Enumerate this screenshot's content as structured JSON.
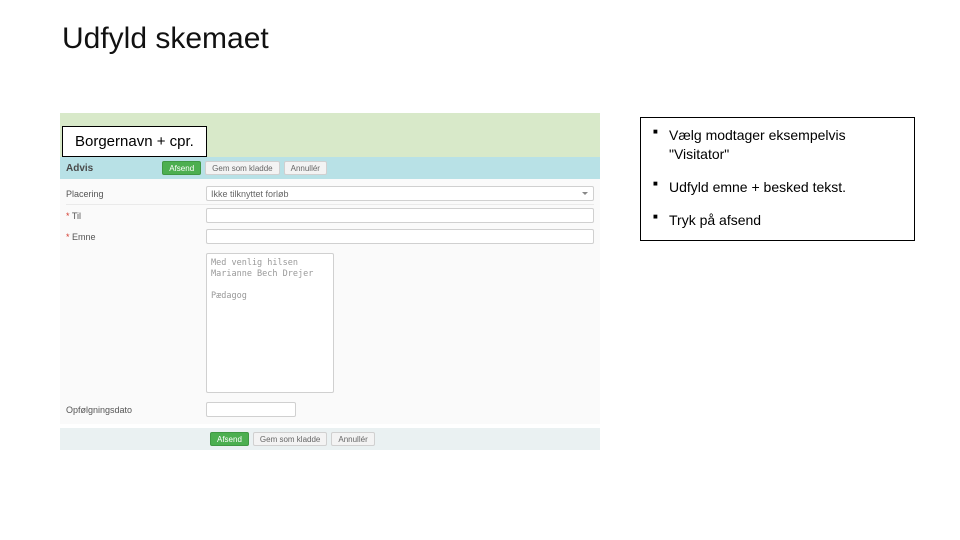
{
  "title": "Udfyld skemaet",
  "callouts": {
    "left": "Borgernavn + cpr.",
    "right": [
      "Vælg modtager eksempelvis \"Visitator\"",
      "Udfyld emne + besked tekst.",
      "Tryk på afsend"
    ]
  },
  "header": {
    "advis": "Advis",
    "btn_send": "Afsend",
    "btn_draft": "Gem som kladde",
    "btn_cancel": "Annullér"
  },
  "labels": {
    "placering": "Placering",
    "til": "Til",
    "emne": "Emne",
    "opfolg": "Opfølgningsdato"
  },
  "values": {
    "placering": "Ikke tilknyttet forløb",
    "signature": "Med venlig hilsen\nMarianne Bech Drejer\n\nPædagog"
  }
}
